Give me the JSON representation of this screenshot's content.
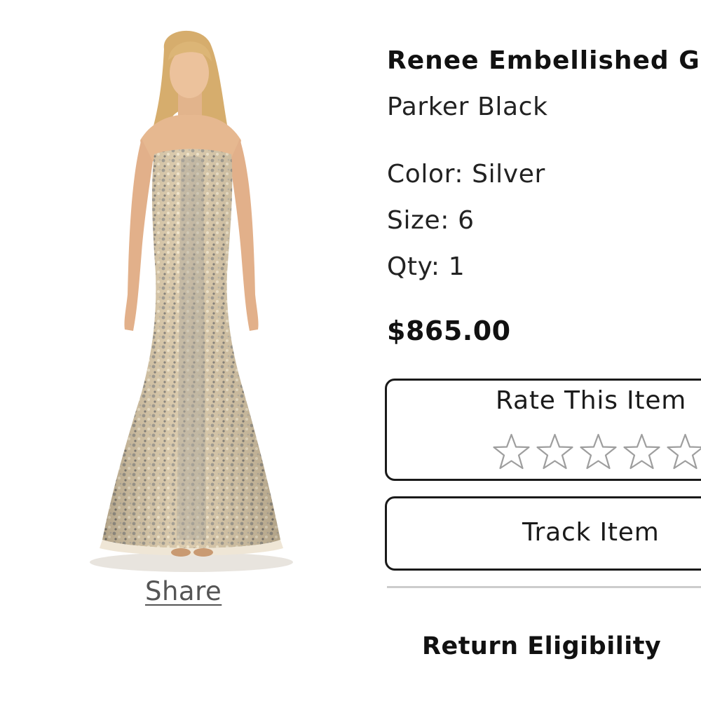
{
  "product": {
    "name": "Renee Embellished Gown",
    "brand": "Parker Black",
    "color": "Color: Silver",
    "size": "Size: 6",
    "qty": "Qty: 1",
    "price": "$865.00"
  },
  "image": {
    "share_label": "Share",
    "colors": {
      "skin": "#e6b890",
      "hair": "#d9b071",
      "gown": "#d6c3a2",
      "sequin": "#a59f94"
    }
  },
  "rating": {
    "title": "Rate This Item",
    "max_stars": 5,
    "current_rating": 0,
    "star_outline_color": "#9e9e9e"
  },
  "actions": {
    "track_label": "Track Item",
    "return_label": "Return Eligibility"
  },
  "icons": {
    "star": "star-outline-icon"
  }
}
